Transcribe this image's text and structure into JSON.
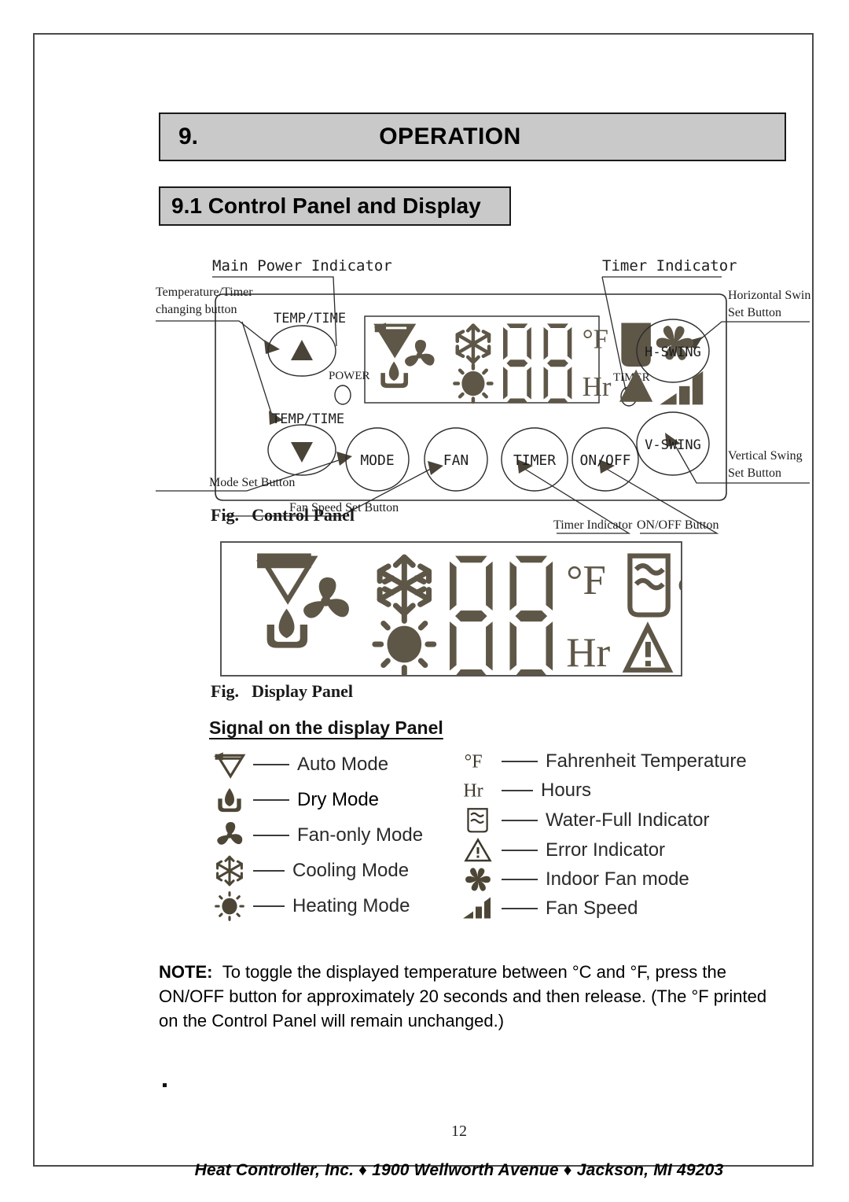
{
  "page": {
    "chapter_number": "9.",
    "chapter_title": "OPERATION",
    "section_title": "9.1 Control Panel and Display",
    "page_number": "12",
    "footer": "Heat Controller, Inc. ♦ 1900 Wellworth Avenue ♦ Jackson, MI   49203",
    "stray_mark": "."
  },
  "control_panel_figure": {
    "caption_prefix": "Fig.",
    "caption_text": "Control Panel",
    "callouts": {
      "main_power_indicator": "Main Power Indicator",
      "timer_indicator_top": "Timer Indicator",
      "temp_timer_changing_button_l1": "Temperature/Timer",
      "temp_timer_changing_button_l2": "changing button",
      "horizontal_swing_l1": "Horizontal Swing",
      "horizontal_swing_l2": "Set Button",
      "vertical_swing_l1": "Vertical Swing",
      "vertical_swing_l2": "Set Button",
      "mode_set_button": "Mode Set Button",
      "fan_speed_set_button": "Fan Speed Set Button",
      "timer_indicator_bottom": "Timer Indicator",
      "on_off_button": "ON/OFF Button"
    },
    "panel_labels": {
      "temp_time_up": "TEMP/TIME",
      "temp_time_down": "TEMP/TIME",
      "power_led": "POWER",
      "timer_led": "TIMER"
    },
    "buttons": [
      {
        "label": "H-SWING",
        "name": "h-swing-button"
      },
      {
        "label": "V-SWING",
        "name": "v-swing-button"
      },
      {
        "label": "MODE",
        "name": "mode-button"
      },
      {
        "label": "FAN",
        "name": "fan-button"
      },
      {
        "label": "TIMER",
        "name": "timer-button"
      },
      {
        "label": "ON/OFF",
        "name": "on-off-button"
      }
    ],
    "lcd_segments": {
      "digits": "88",
      "unit_temp": "°F",
      "unit_hours": "Hr"
    }
  },
  "display_panel_figure": {
    "caption_prefix": "Fig.",
    "caption_text": "Display Panel",
    "segments": {
      "digits": "88",
      "unit_temp": "°F",
      "unit_hours": "Hr"
    }
  },
  "legend": {
    "title": "Signal on the display Panel",
    "left_items": [
      {
        "icon": "auto-mode-icon",
        "label": "Auto Mode"
      },
      {
        "icon": "dry-mode-icon",
        "label": "Dry Mode"
      },
      {
        "icon": "fan-only-mode-icon",
        "label": "Fan-only Mode"
      },
      {
        "icon": "cooling-mode-icon",
        "label": "Cooling Mode"
      },
      {
        "icon": "heating-mode-icon",
        "label": "Heating Mode"
      }
    ],
    "right_items": [
      {
        "icon": "fahrenheit-icon",
        "label": "Fahrenheit Temperature"
      },
      {
        "icon": "hours-icon",
        "label": "Hours"
      },
      {
        "icon": "water-full-icon",
        "label": "Water-Full Indicator"
      },
      {
        "icon": "error-indicator-icon",
        "label": "Error Indicator"
      },
      {
        "icon": "indoor-fan-mode-icon",
        "label": "Indoor Fan mode"
      },
      {
        "icon": "fan-speed-icon",
        "label": "Fan Speed"
      }
    ]
  },
  "note": {
    "prefix": "NOTE:",
    "body": "To toggle the displayed temperature between °C and °F, press the ON/OFF button for approximately 20 seconds and then release.   (The °F printed on the Control Panel will remain unchanged.)"
  }
}
